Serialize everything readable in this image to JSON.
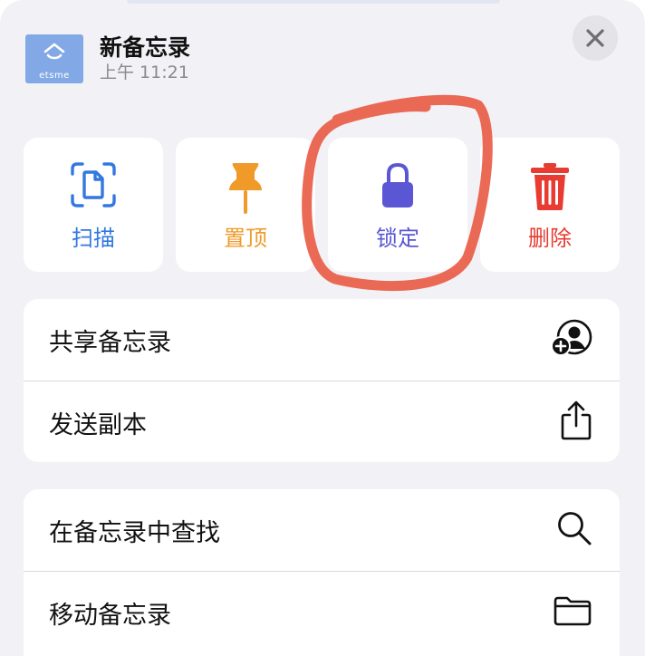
{
  "header": {
    "title": "新备忘录",
    "time": "上午 11:21",
    "thumb_text": "etsme",
    "close_icon": "close-icon"
  },
  "actions": [
    {
      "label": "扫描",
      "icon": "scan-document-icon",
      "color": "#3378e0"
    },
    {
      "label": "置顶",
      "icon": "pin-icon",
      "color": "#f09a2a"
    },
    {
      "label": "锁定",
      "icon": "lock-icon",
      "color": "#5a56d4"
    },
    {
      "label": "删除",
      "icon": "trash-icon",
      "color": "#e83b32"
    }
  ],
  "menu_group_1": [
    {
      "label": "共享备忘录",
      "icon": "share-person-add-icon"
    },
    {
      "label": "发送副本",
      "icon": "share-upload-icon"
    }
  ],
  "menu_group_2": [
    {
      "label": "在备忘录中查找",
      "icon": "search-icon"
    },
    {
      "label": "移动备忘录",
      "icon": "folder-icon"
    }
  ],
  "colors": {
    "background": "#f2f2f6",
    "annotation": "#e8553f"
  }
}
